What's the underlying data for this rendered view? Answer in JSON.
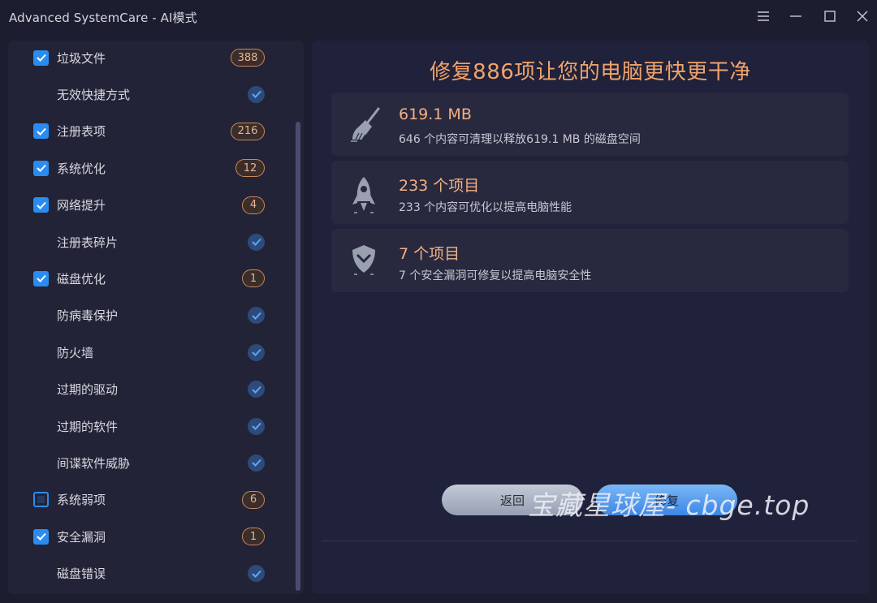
{
  "window": {
    "title": "Advanced SystemCare - AI模式",
    "controls": [
      "menu-icon",
      "minimize-icon",
      "maximize-icon",
      "close-icon"
    ]
  },
  "sidebar": {
    "items": [
      {
        "label": "垃圾文件",
        "checkbox": "checked",
        "count": "388",
        "top": 0
      },
      {
        "label": "无效快捷方式",
        "checkbox": "none",
        "status": "ok"
      },
      {
        "label": "注册表项",
        "checkbox": "checked",
        "count": "216"
      },
      {
        "label": "系统优化",
        "checkbox": "checked",
        "count": "12"
      },
      {
        "label": "网络提升",
        "checkbox": "checked",
        "count": "4"
      },
      {
        "label": "注册表碎片",
        "checkbox": "none",
        "status": "ok"
      },
      {
        "label": "磁盘优化",
        "checkbox": "checked",
        "count": "1"
      },
      {
        "label": "防病毒保护",
        "checkbox": "none",
        "status": "ok"
      },
      {
        "label": "防火墙",
        "checkbox": "none",
        "status": "ok"
      },
      {
        "label": "过期的驱动",
        "checkbox": "none",
        "status": "ok"
      },
      {
        "label": "过期的软件",
        "checkbox": "none",
        "status": "ok"
      },
      {
        "label": "间谍软件威胁",
        "checkbox": "none",
        "status": "ok"
      },
      {
        "label": "系统弱项",
        "checkbox": "partial",
        "count": "6"
      },
      {
        "label": "安全漏洞",
        "checkbox": "checked",
        "count": "1"
      },
      {
        "label": "磁盘错误",
        "checkbox": "none",
        "status": "ok"
      }
    ]
  },
  "main": {
    "headline": "修复886项让您的电脑更快更干净",
    "cards": [
      {
        "icon": "broom-icon",
        "title": "619.1 MB",
        "desc": "646 个内容可清理以释放619.1 MB 的磁盘空间"
      },
      {
        "icon": "rocket-icon",
        "title": "233 个项目",
        "desc": "233 个内容可优化以提高电脑性能"
      },
      {
        "icon": "shield-icon",
        "title": "7 个项目",
        "desc": "7 个安全漏洞可修复以提高电脑安全性"
      }
    ],
    "buttons": {
      "back": "返回",
      "fix": "修复"
    }
  },
  "watermark": "宝藏星球屋- cbge.top",
  "colors": {
    "accent_blue": "#2a8cf0",
    "accent_orange": "#f0a36a",
    "background": "#1c1d2e"
  }
}
